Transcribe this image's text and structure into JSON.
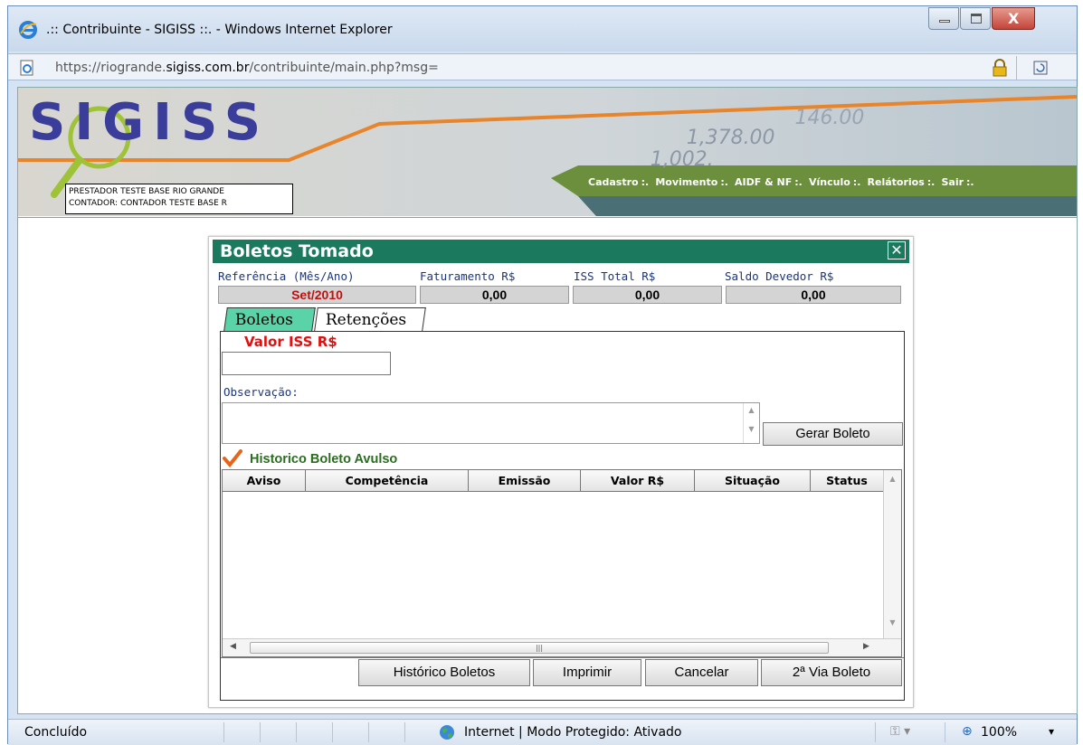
{
  "window": {
    "title": ".:: Contribuinte - SIGISS ::. - Windows Internet Explorer"
  },
  "address": {
    "scheme": "https://",
    "host_prefix": "riogrande.",
    "host": "sigiss.com.br",
    "path": "/contribuinte/main.php?msg="
  },
  "banner": {
    "logo": "SIGISS",
    "prestador": "PRESTADOR TESTE BASE RIO GRANDE",
    "contador": "CONTADOR: CONTADOR TESTE BASE R",
    "menu": [
      "Cadastro",
      "Movimento",
      "AIDF & NF",
      "Vínculo",
      "Relátorios",
      "Sair"
    ],
    "menu_separator": ":."
  },
  "dialog": {
    "title": "Boletos Tomado",
    "close_label": "✕",
    "fields": [
      {
        "label": "Referência (Mês/Ano)",
        "value": "Set/2010",
        "highlight": "#c01010"
      },
      {
        "label": "Faturamento R$",
        "value": "0,00"
      },
      {
        "label": "ISS Total R$",
        "value": "0,00"
      },
      {
        "label": "Saldo Devedor R$",
        "value": "0,00"
      }
    ],
    "tabs": [
      {
        "label": "Boletos",
        "active": true
      },
      {
        "label": "Retenções",
        "active": false
      }
    ],
    "valor_label": "Valor ISS R$",
    "valor_value": "",
    "obs_label": "Observação:",
    "obs_value": "",
    "gerar_button": "Gerar Boleto",
    "historico_title": "Historico Boleto Avulso",
    "grid_columns": [
      "Aviso",
      "Competência",
      "Emissão",
      "Valor R$",
      "Situação",
      "Status"
    ],
    "grid_rows": [],
    "buttons": {
      "historico": "Histórico Boletos",
      "imprimir": "Imprimir",
      "cancelar": "Cancelar",
      "segunda_via": "2ª Via Boleto"
    }
  },
  "statusbar": {
    "status": "Concluído",
    "zone": "Internet | Modo Protegido: Ativado",
    "zoom": "100%"
  },
  "colors": {
    "dialog_title_bg": "#1b7a5e",
    "tab_active_bg": "#5bd3a8",
    "menu_bar_bg": "#6b8f3c",
    "logo": "#3a3e9a"
  },
  "icons": [
    "ie-logo-icon",
    "page-icon",
    "lock-icon",
    "refresh-icon",
    "check-icon",
    "globe-icon",
    "zoom-icon"
  ]
}
